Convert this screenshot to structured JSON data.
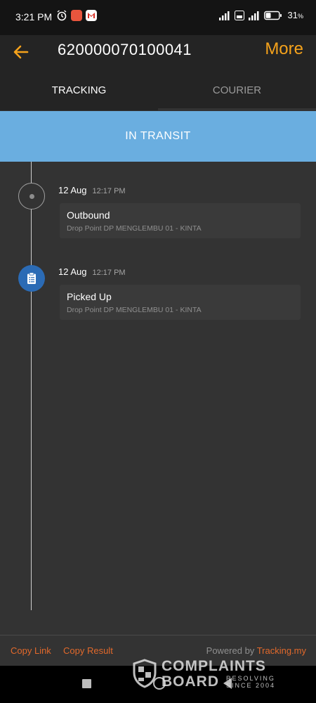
{
  "status_bar": {
    "time": "3:21 PM",
    "battery": "31",
    "battery_unit": "%",
    "icons": [
      "alarm-icon",
      "app-badge-icon",
      "gmail-icon",
      "signal-icon",
      "volte-icon",
      "4g-signal-icon",
      "battery-icon"
    ]
  },
  "header": {
    "title": "620000070100041",
    "more_label": "More",
    "accent": "#f5a21b"
  },
  "tabs": [
    {
      "label": "TRACKING",
      "active": true
    },
    {
      "label": "COURIER",
      "active": false
    }
  ],
  "status_band": {
    "label": "IN TRANSIT",
    "color": "#6aaee0"
  },
  "events": [
    {
      "date": "12 Aug",
      "time": "12:17 PM",
      "title": "Outbound",
      "location": "Drop Point DP MENGLEMBU 01 - KINTA",
      "icon": "dot-icon"
    },
    {
      "date": "12 Aug",
      "time": "12:17 PM",
      "title": "Picked Up",
      "location": "Drop Point DP MENGLEMBU 01 - KINTA",
      "icon": "clipboard-icon"
    }
  ],
  "footer": {
    "copy_link": "Copy Link",
    "copy_result": "Copy Result",
    "powered_prefix": "Powered by ",
    "powered_brand": "Tracking.my",
    "link_color": "#e2692b"
  },
  "watermark": {
    "line1": "COMPLAINTS",
    "line2": "BOARD",
    "tagline1": "RESOLVING",
    "tagline2": "SINCE 2004"
  }
}
